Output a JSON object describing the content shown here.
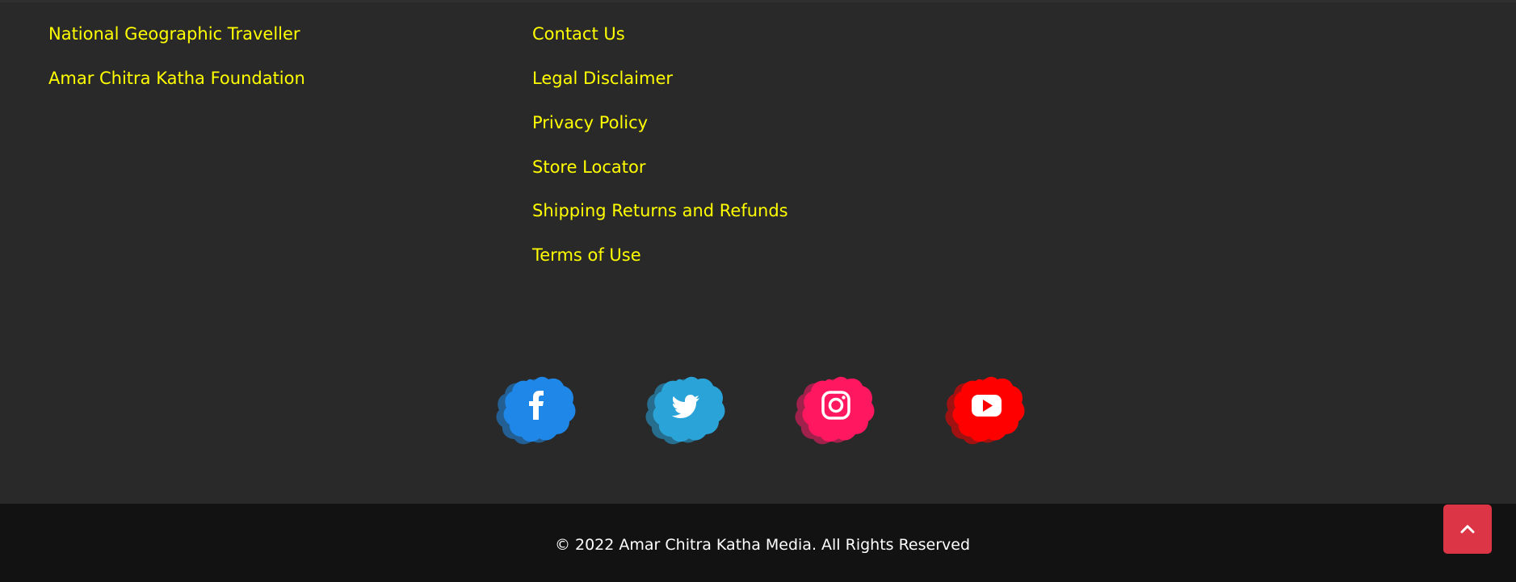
{
  "footer": {
    "links_column_1": [
      "National Geographic Traveller",
      "Amar Chitra Katha Foundation"
    ],
    "links_column_2": [
      "Contact Us",
      "Legal Disclaimer",
      "Privacy Policy",
      "Store Locator",
      "Shipping Returns and Refunds",
      "Terms of Use"
    ],
    "link_color": "#ffff00",
    "background_color": "#292929",
    "bottom_bar_color": "#121212"
  },
  "social": [
    {
      "network": "facebook",
      "icon": "facebook-icon",
      "color": "#1e87e8",
      "shadow": "#235f93"
    },
    {
      "network": "twitter",
      "icon": "twitter-icon",
      "color": "#2aa4d8",
      "shadow": "#276e8e"
    },
    {
      "network": "instagram",
      "icon": "instagram-icon",
      "color": "#ff175f",
      "shadow": "#a0214b"
    },
    {
      "network": "youtube",
      "icon": "youtube-icon",
      "color": "#ff0000",
      "shadow": "#a01212"
    }
  ],
  "copyright": "© 2022  Amar Chitra Katha Media. All Rights Reserved",
  "back_to_top": {
    "icon": "chevron-up-icon",
    "color": "#dc3545"
  }
}
